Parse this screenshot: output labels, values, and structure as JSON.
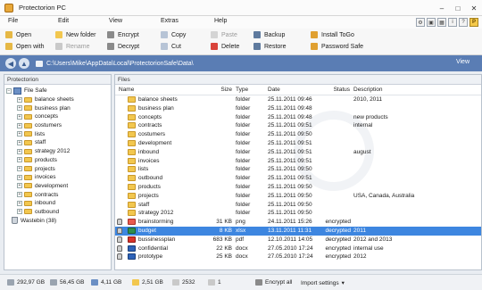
{
  "window": {
    "title": "Protectorion PC"
  },
  "menu": [
    "File",
    "Edit",
    "View",
    "Extras",
    "Help"
  ],
  "toolbar": {
    "open": "Open",
    "open_with": "Open with",
    "new_folder": "New folder",
    "rename": "Rename",
    "encrypt": "Encrypt",
    "decrypt": "Decrypt",
    "copy": "Copy",
    "cut": "Cut",
    "paste": "Paste",
    "delete": "Delete",
    "backup": "Backup",
    "restore": "Restore",
    "install_togo": "Install ToGo",
    "password_safe": "Password Safe"
  },
  "address": {
    "path": "C:\\Users\\Mike\\AppData\\Local\\ProtectorionSafe\\Data\\",
    "view_label": "View"
  },
  "left_panel": {
    "title": "Protectorion",
    "root": "File Safe",
    "folders": [
      "balance sheets",
      "business plan",
      "concepts",
      "costumers",
      "lists",
      "staff",
      "strategy 2012",
      "products",
      "projects",
      "invoices",
      "development",
      "contracts",
      "inbound",
      "outbound"
    ],
    "wastebin": "Wastebin (38)"
  },
  "right_panel": {
    "title": "Files",
    "columns": {
      "name": "Name",
      "size": "Size",
      "type": "Type",
      "date": "Date",
      "status": "Status",
      "description": "Description"
    },
    "rows": [
      {
        "name": "balance sheets",
        "size": "",
        "type": "folder",
        "date": "25.11.2011 09:46",
        "status": "",
        "description": "2010, 2011"
      },
      {
        "name": "business plan",
        "size": "",
        "type": "folder",
        "date": "25.11.2011 09:48",
        "status": "",
        "description": ""
      },
      {
        "name": "concepts",
        "size": "",
        "type": "folder",
        "date": "25.11.2011 09:48",
        "status": "",
        "description": "new products"
      },
      {
        "name": "contracts",
        "size": "",
        "type": "folder",
        "date": "25.11.2011 09:51",
        "status": "",
        "description": "internal"
      },
      {
        "name": "costumers",
        "size": "",
        "type": "folder",
        "date": "25.11.2011 09:50",
        "status": "",
        "description": ""
      },
      {
        "name": "development",
        "size": "",
        "type": "folder",
        "date": "25.11.2011 09:51",
        "status": "",
        "description": ""
      },
      {
        "name": "inbound",
        "size": "",
        "type": "folder",
        "date": "25.11.2011 09:51",
        "status": "",
        "description": "august"
      },
      {
        "name": "invoices",
        "size": "",
        "type": "folder",
        "date": "25.11.2011 09:51",
        "status": "",
        "description": ""
      },
      {
        "name": "lists",
        "size": "",
        "type": "folder",
        "date": "25.11.2011 09:50",
        "status": "",
        "description": ""
      },
      {
        "name": "outbound",
        "size": "",
        "type": "folder",
        "date": "25.11.2011 09:51",
        "status": "",
        "description": ""
      },
      {
        "name": "products",
        "size": "",
        "type": "folder",
        "date": "25.11.2011 09:50",
        "status": "",
        "description": ""
      },
      {
        "name": "projects",
        "size": "",
        "type": "folder",
        "date": "25.11.2011 09:50",
        "status": "",
        "description": "USA, Canada, Australia"
      },
      {
        "name": "staff",
        "size": "",
        "type": "folder",
        "date": "25.11.2011 09:50",
        "status": "",
        "description": ""
      },
      {
        "name": "strategy 2012",
        "size": "",
        "type": "folder",
        "date": "25.11.2011 09:50",
        "status": "",
        "description": ""
      },
      {
        "name": "brainstorming",
        "size": "31 KB",
        "type": "png",
        "date": "24.11.2011 15:26",
        "status": "encrypted",
        "description": ""
      },
      {
        "name": "budget",
        "size": "8 KB",
        "type": "xlsx",
        "date": "13.11.2011 11:31",
        "status": "decrypted",
        "description": "2011"
      },
      {
        "name": "bussinessplan",
        "size": "683 KB",
        "type": "pdf",
        "date": "12.10.2011 14:05",
        "status": "decrypted",
        "description": "2012 and 2013"
      },
      {
        "name": "confidential",
        "size": "22 KB",
        "type": "docx",
        "date": "27.05.2010 17:24",
        "status": "encrypted",
        "description": "internal use"
      },
      {
        "name": "prototype",
        "size": "25 KB",
        "type": "docx",
        "date": "27.05.2010 17:24",
        "status": "encrypted",
        "description": "2012"
      }
    ]
  },
  "statusbar": {
    "disk_total": "292,97 GB",
    "disk_free": "56,45 GB",
    "safe_size": "4,11 GB",
    "safe_used": "2,51 GB",
    "file_count": "2532",
    "selected": "1",
    "encrypt_all": "Encrypt all",
    "import_settings": "Import settings"
  }
}
